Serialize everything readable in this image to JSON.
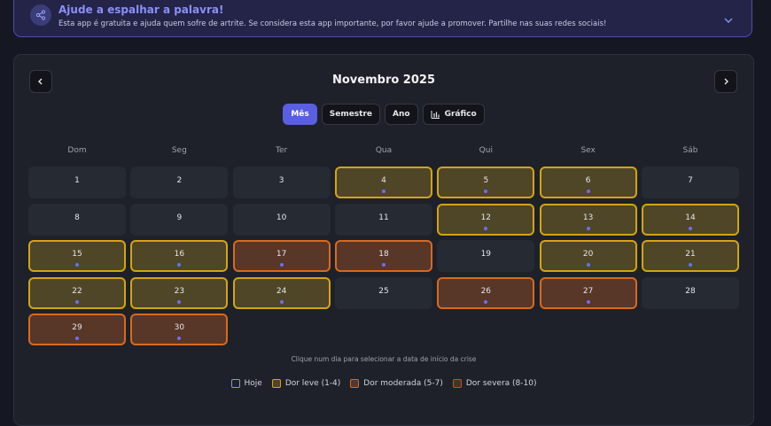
{
  "banner": {
    "icon": "share-icon",
    "title": "Ajude a espalhar a palavra!",
    "text": "Esta app é gratuita e ajuda quem sofre de artrite. Se considera esta app importante, por favor ajude a promover. Partilhe nas suas redes sociais!",
    "expand_icon": "chevron-down-icon"
  },
  "calendar": {
    "title": "Novembro 2025",
    "prev_icon": "chevron-left-icon",
    "next_icon": "chevron-right-icon",
    "views": [
      {
        "label": "Mês",
        "active": true
      },
      {
        "label": "Semestre",
        "active": false
      },
      {
        "label": "Ano",
        "active": false
      },
      {
        "label": "Gráfico",
        "active": false,
        "icon": "bar-chart-icon"
      }
    ],
    "weekdays": [
      "Dom",
      "Seg",
      "Ter",
      "Qua",
      "Qui",
      "Sex",
      "Sáb"
    ],
    "days": [
      {
        "n": "1",
        "level": "none"
      },
      {
        "n": "2",
        "level": "none"
      },
      {
        "n": "3",
        "level": "none"
      },
      {
        "n": "4",
        "level": "leve"
      },
      {
        "n": "5",
        "level": "leve"
      },
      {
        "n": "6",
        "level": "leve"
      },
      {
        "n": "7",
        "level": "none"
      },
      {
        "n": "8",
        "level": "none"
      },
      {
        "n": "9",
        "level": "none"
      },
      {
        "n": "10",
        "level": "none"
      },
      {
        "n": "11",
        "level": "none"
      },
      {
        "n": "12",
        "level": "leve"
      },
      {
        "n": "13",
        "level": "leve"
      },
      {
        "n": "14",
        "level": "leve"
      },
      {
        "n": "15",
        "level": "leve"
      },
      {
        "n": "16",
        "level": "leve"
      },
      {
        "n": "17",
        "level": "moderada"
      },
      {
        "n": "18",
        "level": "moderada"
      },
      {
        "n": "19",
        "level": "none"
      },
      {
        "n": "20",
        "level": "leve"
      },
      {
        "n": "21",
        "level": "leve"
      },
      {
        "n": "22",
        "level": "leve"
      },
      {
        "n": "23",
        "level": "leve"
      },
      {
        "n": "24",
        "level": "leve"
      },
      {
        "n": "25",
        "level": "none"
      },
      {
        "n": "26",
        "level": "moderada"
      },
      {
        "n": "27",
        "level": "moderada"
      },
      {
        "n": "28",
        "level": "none"
      },
      {
        "n": "29",
        "level": "moderada"
      },
      {
        "n": "30",
        "level": "moderada"
      }
    ],
    "first_weekday_index": 6,
    "hint": "Clique num dia para selecionar a data de início da crise",
    "legend": [
      {
        "label": "Hoje",
        "key": "hoje"
      },
      {
        "label": "Dor leve (1-4)",
        "key": "leve"
      },
      {
        "label": "Dor moderada (5-7)",
        "key": "mod"
      },
      {
        "label": "Dor severa (8-10)",
        "key": "sev"
      }
    ]
  },
  "colors": {
    "accent": "#5a5ee0",
    "leve_border": "#d4a412",
    "moderada_border": "#d86a1f",
    "severa_border": "#c0532a"
  }
}
